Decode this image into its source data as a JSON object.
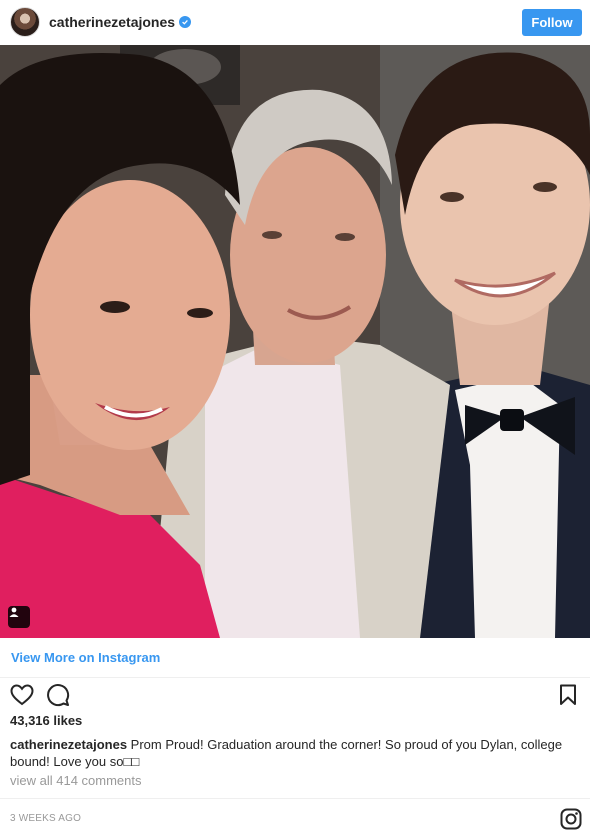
{
  "header": {
    "username": "catherinezetajones",
    "follow_label": "Follow"
  },
  "photo": {
    "alt_subjects": [
      "woman in pink dress",
      "older man in light suit",
      "young man in tuxedo with bow tie"
    ]
  },
  "view_more_label": "View More on Instagram",
  "engagement": {
    "likes_text": "43,316 likes"
  },
  "caption": {
    "username": "catherinezetajones",
    "text": "Prom Proud! Graduation around the corner! So proud of you Dylan, college bound! Love you so□□"
  },
  "comments_link": "view all 414 comments",
  "timestamp": "3 weeks ago",
  "colors": {
    "accent": "#3897f0",
    "text": "#262626",
    "muted": "#999999",
    "divider": "#efefef"
  },
  "icons": [
    "verified-badge-icon",
    "heart-icon",
    "comment-icon",
    "bookmark-icon",
    "user-tag-icon",
    "instagram-logo-icon"
  ]
}
